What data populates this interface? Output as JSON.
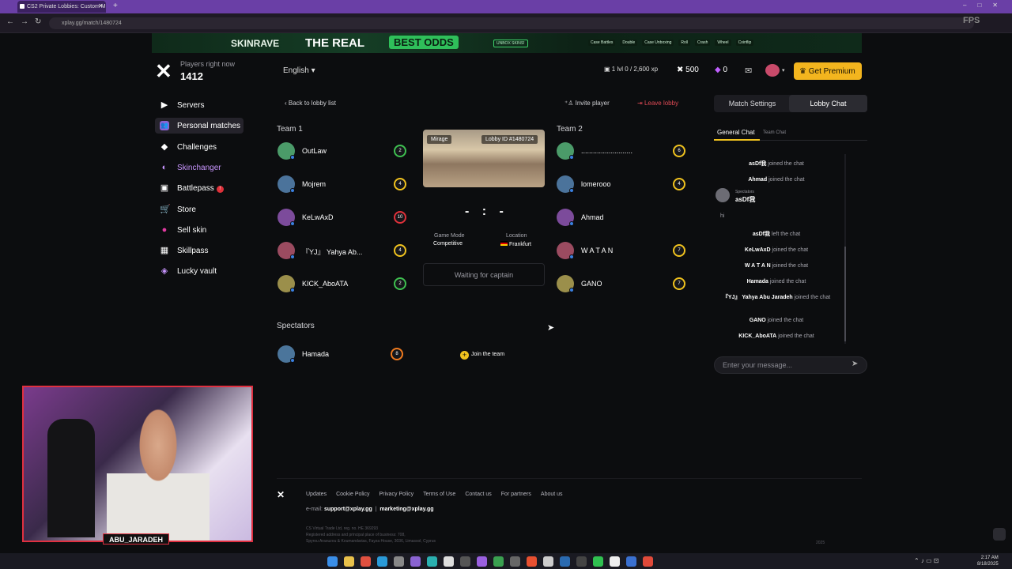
{
  "browser": {
    "tab_title": "CS2 Private Lobbies: Custom M",
    "url": "xplay.gg/match/1480724",
    "overlay": "FPS"
  },
  "banner": {
    "brand": "SKINRAVE",
    "headline": "THE REAL",
    "highlight": "BEST ODDS",
    "cta": "UNBOX SKINS!",
    "nav": [
      "Case Battles",
      "Double",
      "Case Unboxing",
      "Roll",
      "Crash",
      "Wheel",
      "Coinflip"
    ]
  },
  "sidebar": {
    "players_label": "Players right now",
    "players_count": "1412",
    "items": [
      {
        "label": "Servers",
        "icon": "play-icon"
      },
      {
        "label": "Personal matches",
        "icon": "users-icon"
      },
      {
        "label": "Challenges",
        "icon": "puzzle-icon"
      },
      {
        "label": "Skinchanger",
        "icon": "skinchanger-icon"
      },
      {
        "label": "Battlepass",
        "icon": "battlepass-icon",
        "badge": "!"
      },
      {
        "label": "Store",
        "icon": "cart-icon"
      },
      {
        "label": "Sell skin",
        "icon": "sell-icon"
      },
      {
        "label": "Skillpass",
        "icon": "skillpass-icon"
      },
      {
        "label": "Lucky vault",
        "icon": "vault-icon"
      }
    ]
  },
  "header": {
    "language": "English",
    "level": "1 lvl",
    "xp": "0 / 2,600 xp",
    "coins": "500",
    "gems": "0",
    "premium": "Get Premium"
  },
  "lobby": {
    "back": "Back to lobby list",
    "invite": "Invite player",
    "leave": "Leave lobby",
    "map": "Mirage",
    "lobby_id": "Lobby ID #1480724",
    "score": "- : -",
    "mode_label": "Game Mode",
    "mode_value": "Competitive",
    "location_label": "Location",
    "location_value": "Frankfurt",
    "waiting": "Waiting for captain",
    "join": "Join the team",
    "team1_title": "Team 1",
    "team2_title": "Team 2",
    "spectators_title": "Spectators",
    "team1": [
      {
        "name": "OutLaw",
        "level": "2",
        "ring": "#3fc050"
      },
      {
        "name": "Mojrem",
        "level": "4",
        "ring": "#f0c21e"
      },
      {
        "name": "KeLwAxD",
        "level": "10",
        "ring": "#e0313a"
      },
      {
        "name": "『YJ』 Yahya Ab...",
        "level": "4",
        "ring": "#f0c21e"
      },
      {
        "name": "KICK_AboATA",
        "level": "2",
        "ring": "#3fc050"
      }
    ],
    "team2": [
      {
        "name": "..........................",
        "level": "6",
        "ring": "#f0c21e"
      },
      {
        "name": "lomerooo",
        "level": "4",
        "ring": "#f0c21e"
      },
      {
        "name": "Ahmad",
        "level": "",
        "ring": ""
      },
      {
        "name": "W A T A N",
        "level": "7",
        "ring": "#f0c21e"
      },
      {
        "name": "GANO",
        "level": "7",
        "ring": "#f0c21e"
      }
    ],
    "spectators": [
      {
        "name": "Hamada",
        "level": "8",
        "ring": "#f07a1e"
      }
    ]
  },
  "chat": {
    "tab_settings": "Match Settings",
    "tab_chat": "Lobby Chat",
    "general": "General Chat",
    "team": "Team Chat",
    "spectator_label": "Spectators",
    "spectator_name": "asDf我",
    "spectator_msg": "hi",
    "joined": "joined the chat",
    "left": "left the chat",
    "messages_top": [
      {
        "user": "asDf我",
        "text": "joined the chat"
      },
      {
        "user": "Ahmad",
        "text": "joined the chat"
      }
    ],
    "messages_bottom": [
      {
        "user": "asDf我",
        "text": "left the chat"
      },
      {
        "user": "KeLwAxD",
        "text": "joined the chat"
      },
      {
        "user": "W A T A N",
        "text": "joined the chat"
      },
      {
        "user": "Hamada",
        "text": "joined the chat"
      },
      {
        "user": "『YJ』 Yahya Abu Jaradeh",
        "text": "joined the chat"
      },
      {
        "user": "GANO",
        "text": "joined the chat"
      },
      {
        "user": "KICK_AboATA",
        "text": "joined the chat"
      }
    ],
    "placeholder": "Enter your message..."
  },
  "footer": {
    "links": [
      "Updates",
      "Cookie Policy",
      "Privacy Policy",
      "Terms of Use",
      "Contact us",
      "For partners",
      "About us"
    ],
    "email_label": "e-mail:",
    "email1": "support@xplay.gg",
    "email2": "marketing@xplay.gg",
    "legal1": "CS Virtual Trade Ltd, reg. no. HE 369293",
    "legal2": "Registered address and principal place of business: 708,",
    "legal3": "Spyrou Araouzou & Koumandarias, Fayza House, 3036, Limassol, Cyprus",
    "year": "2025"
  },
  "webcam": {
    "name": "ABU_JARADEH"
  },
  "taskbar": {
    "time": "2:17 AM",
    "date": "8/18/2025"
  }
}
